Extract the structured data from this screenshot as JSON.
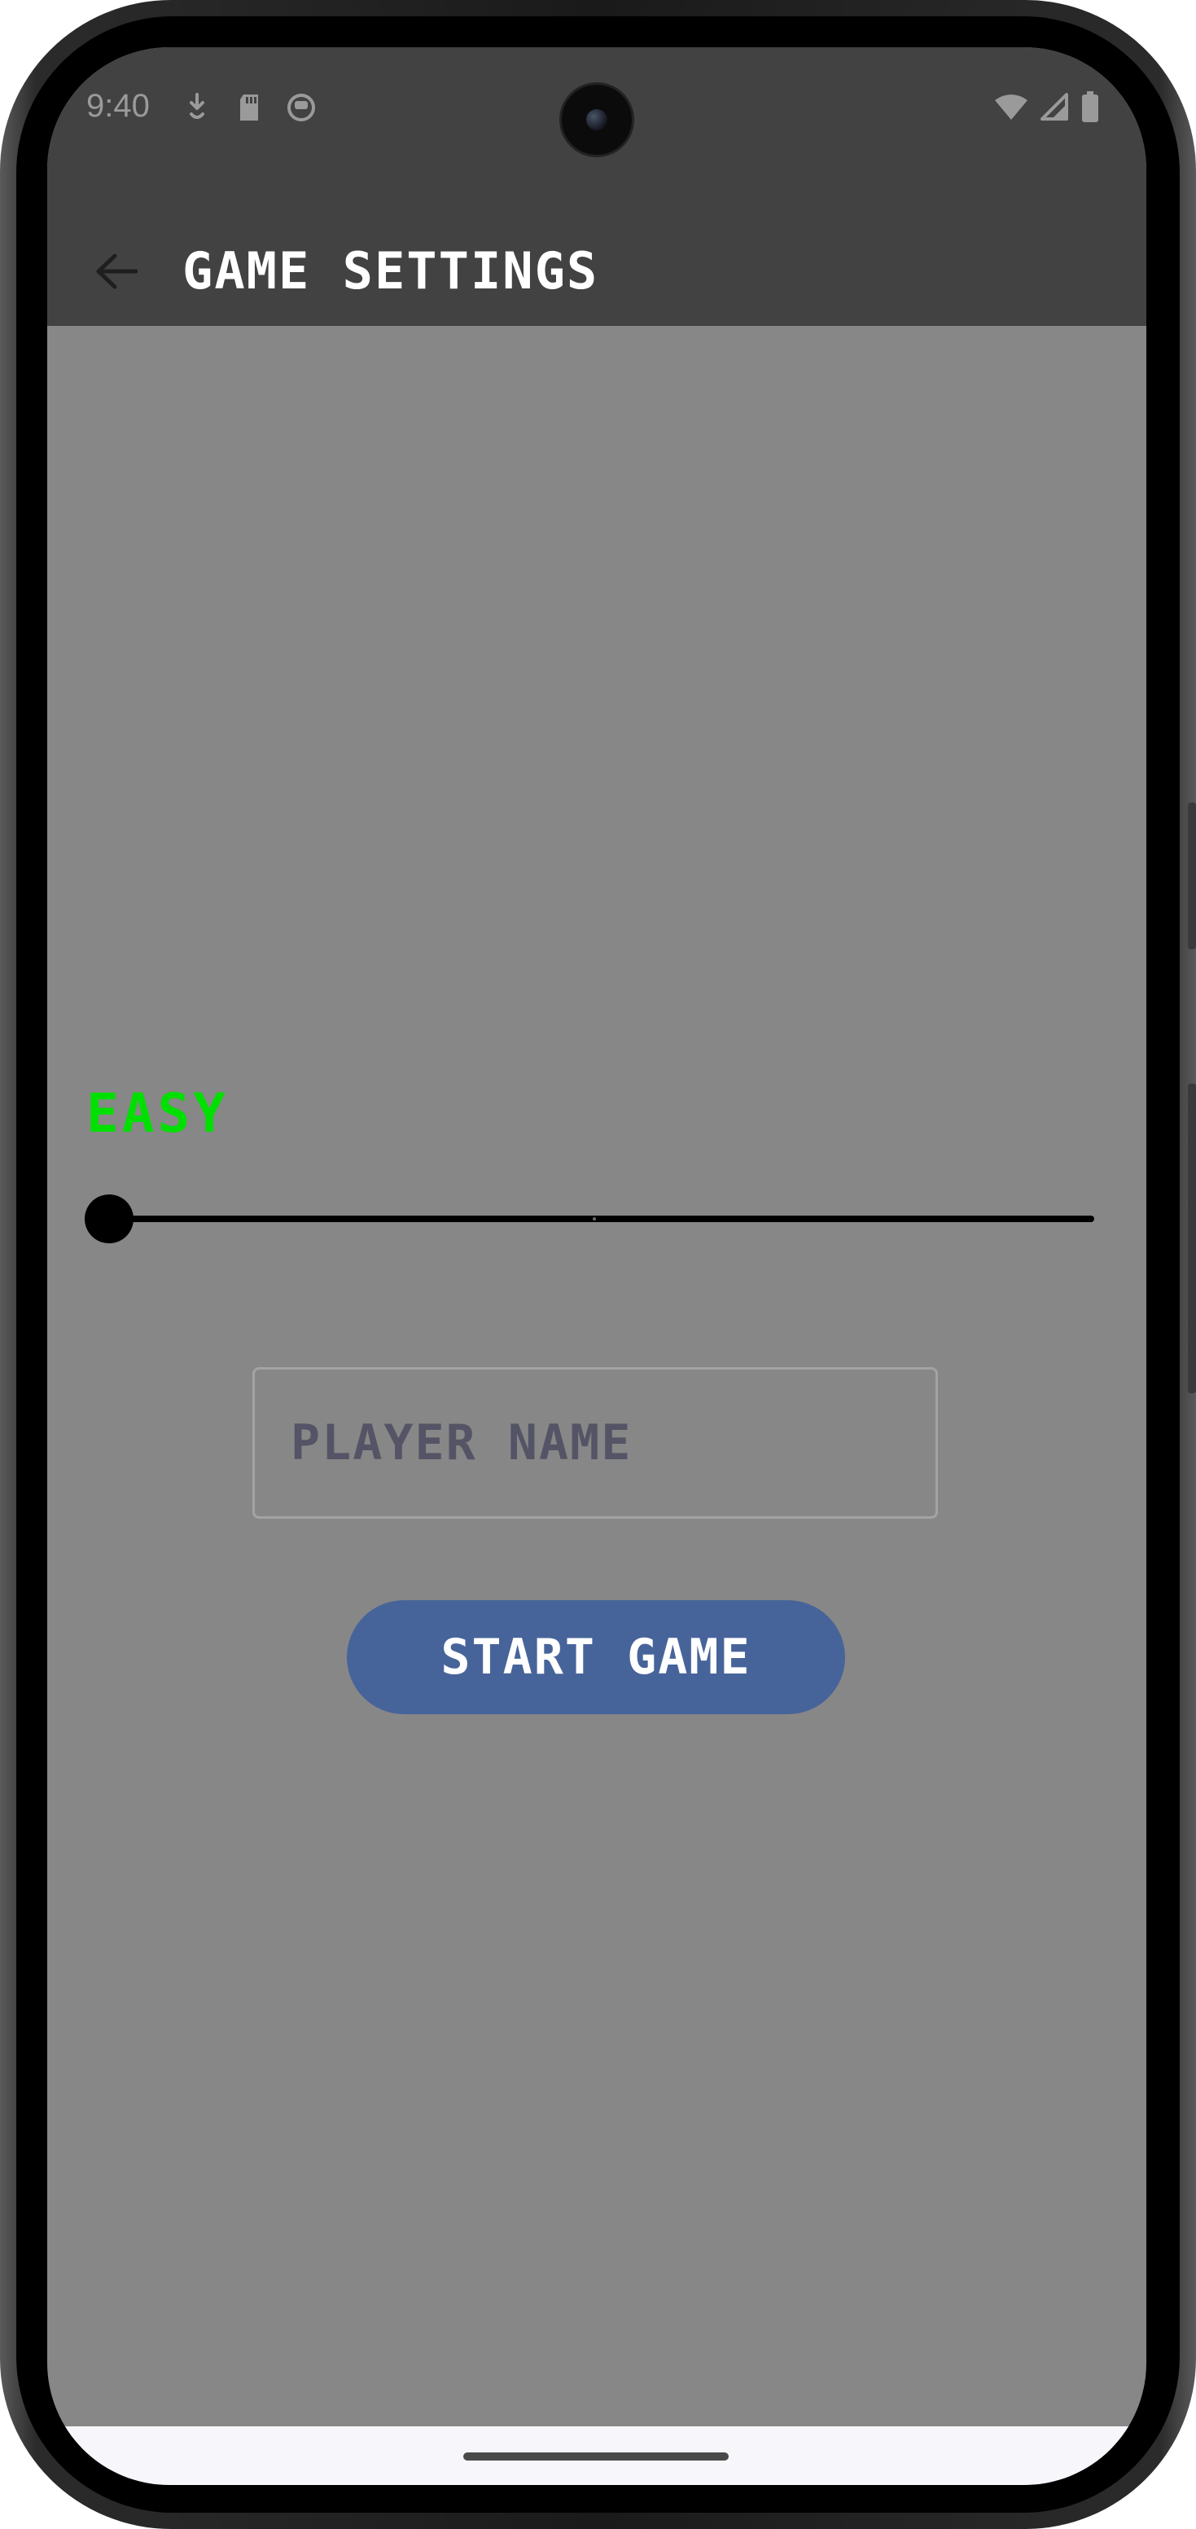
{
  "status_bar": {
    "time": "9:40",
    "left_icons": [
      "download-icon",
      "sd-card-icon",
      "notification-icon"
    ],
    "right_icons": [
      "wifi-icon",
      "cellular-signal-icon",
      "battery-icon"
    ]
  },
  "app_bar": {
    "back_icon": "arrow-back-icon",
    "title": "GAME SETTINGS"
  },
  "difficulty": {
    "label": "EASY",
    "level_fraction": 0.0,
    "label_color": "#00e000"
  },
  "player_name": {
    "placeholder": "PLAYER NAME",
    "value": ""
  },
  "start_button": {
    "label": "START GAME",
    "color": "#47649a"
  },
  "colors": {
    "app_bar": "#424242",
    "background": "#878787"
  }
}
